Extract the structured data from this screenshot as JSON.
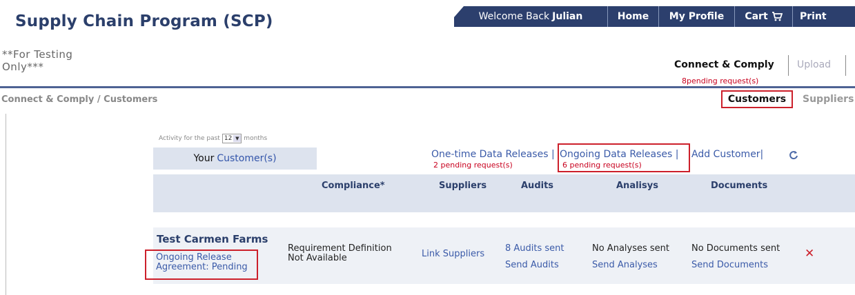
{
  "header": {
    "title": "Supply Chain Program (SCP)",
    "testing_note_line1": "**For Testing",
    "testing_note_line2": "Only***"
  },
  "topnav": {
    "welcome_prefix": "Welcome Back",
    "user_name": "Julian",
    "home": "Home",
    "my_profile": "My Profile",
    "cart": "Cart",
    "print": "Print"
  },
  "tabs": {
    "connect_comply": "Connect & Comply",
    "upload": "Upload",
    "pending": "8pending request(s)"
  },
  "breadcrumb": "Connect & Comply / Customers",
  "subtabs": {
    "customers": "Customers",
    "suppliers": "Suppliers"
  },
  "activity": {
    "prefix": "Activity for the past",
    "value": "12",
    "suffix": "months"
  },
  "your_customers": {
    "prefix": "Your",
    "link": "Customer(s)"
  },
  "releases": {
    "one_time": "One-time Data Releases |",
    "one_time_pending": "2 pending request(s)",
    "ongoing": "Ongoing Data Releases |",
    "ongoing_pending": "6 pending request(s)",
    "add_customer": "Add Customer|"
  },
  "columns": {
    "compliance": "Compliance*",
    "suppliers": "Suppliers",
    "audits": "Audits",
    "analysis": "Analisys",
    "documents": "Documents"
  },
  "row": {
    "customer_name": "Test Carmen Farms",
    "ongoing_line1": "Ongoing Release",
    "ongoing_line2": "Agreement: Pending",
    "requirement_line1": "Requirement Definition",
    "requirement_line2": "Not Available",
    "link_suppliers": "Link Suppliers",
    "audits_sent": "8 Audits sent",
    "send_audits": "Send Audits",
    "analyses_sent": "No Analyses sent",
    "send_analyses": "Send Analyses",
    "documents_sent": "No Documents sent",
    "send_documents": "Send Documents",
    "remove": "✕"
  },
  "icons": {
    "cart": "cart-icon",
    "refresh": "refresh-icon",
    "remove": "remove-icon"
  },
  "colors": {
    "brand": "#2b3f6b",
    "nav_bg": "#2c3f6d",
    "link": "#3a5aa8",
    "alert": "#c8001e",
    "highlight_box": "#cc1f2a",
    "header_row_bg": "#dde3ee"
  }
}
